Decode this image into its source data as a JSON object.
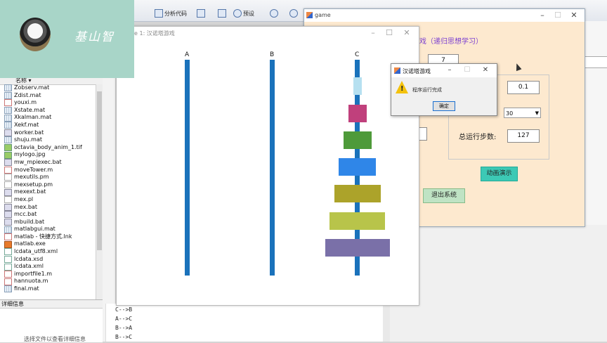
{
  "ribbon": {
    "analyze_code": "分析代码",
    "preferences": "预设"
  },
  "webcam": {
    "name": "基山智"
  },
  "file_browser": {
    "header": "名称 ▾",
    "files": [
      {
        "name": "Zobserv.mat",
        "type": "mat"
      },
      {
        "name": "Zdist.mat",
        "type": "mat"
      },
      {
        "name": "youxi.m",
        "type": "m"
      },
      {
        "name": "Xstate.mat",
        "type": "mat"
      },
      {
        "name": "Xkalman.mat",
        "type": "mat"
      },
      {
        "name": "Xekf.mat",
        "type": "mat"
      },
      {
        "name": "worker.bat",
        "type": "bat"
      },
      {
        "name": "shuju.mat",
        "type": "mat"
      },
      {
        "name": "octavia_body_anim_1.tif",
        "type": "img"
      },
      {
        "name": "mylogo.jpg",
        "type": "img"
      },
      {
        "name": "mw_mpiexec.bat",
        "type": "bat"
      },
      {
        "name": "moveTower.m",
        "type": "m"
      },
      {
        "name": "mexutils.pm",
        "type": "pl"
      },
      {
        "name": "mexsetup.pm",
        "type": "pl"
      },
      {
        "name": "mexext.bat",
        "type": "bat"
      },
      {
        "name": "mex.pl",
        "type": "pl"
      },
      {
        "name": "mex.bat",
        "type": "bat"
      },
      {
        "name": "mcc.bat",
        "type": "bat"
      },
      {
        "name": "mbuild.bat",
        "type": "bat"
      },
      {
        "name": "matlabgui.mat",
        "type": "mat"
      },
      {
        "name": "matlab - 快捷方式.lnk",
        "type": "m"
      },
      {
        "name": "matlab.exe",
        "type": "exe"
      },
      {
        "name": "lcdata_utf8.xml",
        "type": "xml"
      },
      {
        "name": "lcdata.xsd",
        "type": "xml"
      },
      {
        "name": "lcdata.xml",
        "type": "xml"
      },
      {
        "name": "importfile1.m",
        "type": "m"
      },
      {
        "name": "hannuota.m",
        "type": "m"
      },
      {
        "name": "final.mat",
        "type": "mat"
      }
    ]
  },
  "details": {
    "header": "详细信息",
    "message": "选择文件以查看详细信息"
  },
  "command_window": {
    "lines": [
      "C-->B",
      "A-->C",
      "B-->A",
      "B-->C"
    ]
  },
  "figure_window": {
    "title": "are 1: 汉诺塔游戏",
    "rod_labels": [
      "A",
      "B",
      "C"
    ]
  },
  "game_window": {
    "title": "game",
    "heading": "戏（递归思想学习）",
    "disk_count": "7",
    "interval": "0.1",
    "speed_option": "30",
    "steps_label": "总运行步数:",
    "steps_value": "127",
    "animate_button": "动画演示",
    "exit_button": "退出系统"
  },
  "message_box": {
    "title": "汉诺塔游戏",
    "text": "程序运行完成",
    "ok_button": "确定"
  },
  "colors": {
    "rod": "#1a72bb",
    "disks": [
      "#b6e0f0",
      "#c0407c",
      "#4e9a3a",
      "#2f86e8",
      "#aca32a",
      "#b8c44a",
      "#7a70a8"
    ]
  }
}
